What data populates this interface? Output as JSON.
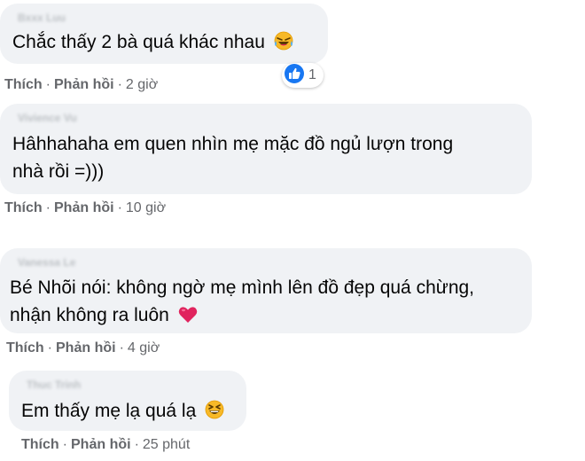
{
  "comments": [
    {
      "text_lines": [
        "Chắc thấy 2 bà quá khác nhau"
      ],
      "emoji": "laughing-tears-emoji",
      "reaction": {
        "icon": "like-icon",
        "count": "1"
      },
      "actions": {
        "like": "Thích",
        "reply": "Phản hồi",
        "time": "2 giờ"
      }
    },
    {
      "text_lines": [
        "Hâhhahaha em quen nhìn mẹ mặc đồ ngủ lượn trong",
        "nhà rồi =)))"
      ],
      "actions": {
        "like": "Thích",
        "reply": "Phản hồi",
        "time": "10 giờ"
      }
    },
    {
      "text_lines": [
        "Bé Nhõi nói: không ngờ mẹ mình lên đồ đẹp quá chừng,",
        "nhận không ra luôn"
      ],
      "emoji": "red-heart-emoji",
      "actions": {
        "like": "Thích",
        "reply": "Phản hồi",
        "time": "4 giờ"
      }
    },
    {
      "text_lines": [
        "Em thấy mẹ lạ quá lạ"
      ],
      "emoji": "grinning-squinting-emoji",
      "actions": {
        "like": "Thích",
        "reply": "Phản hồi",
        "time": "25 phút"
      }
    }
  ],
  "colors": {
    "bubble": "#f0f2f5",
    "text": "#050505",
    "meta": "#65676b",
    "like_blue": "#1877f2",
    "heart_red": "#e0245e",
    "emoji_yellow": "#f7b928"
  }
}
